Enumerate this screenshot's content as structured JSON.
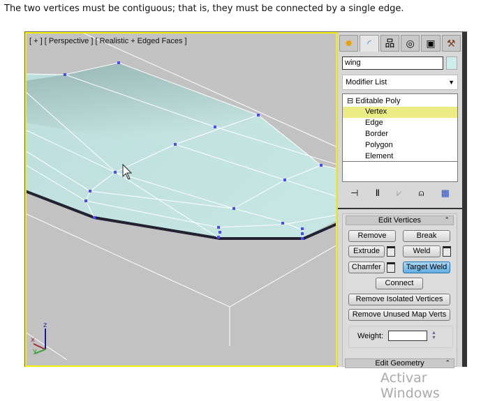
{
  "caption": "The two vertices must be contiguous; that is, they must be connected by a single edge.",
  "viewport": {
    "label": "[ + ] [ Perspective ] [ Realistic + Edged Faces ]",
    "axes": {
      "x": "x",
      "y": "y",
      "z": "z"
    }
  },
  "panel": {
    "tabs": [
      {
        "icon": "create-icon"
      },
      {
        "icon": "modify-icon"
      },
      {
        "icon": "hierarchy-icon"
      },
      {
        "icon": "motion-icon"
      },
      {
        "icon": "display-icon"
      },
      {
        "icon": "utilities-hammer-icon"
      }
    ],
    "object_name": "wing",
    "object_color": "#cdeeea",
    "modifier_list": "Modifier List",
    "stack": {
      "root": "Editable Poly",
      "items": [
        "Vertex",
        "Edge",
        "Border",
        "Polygon",
        "Element"
      ],
      "selected": "Vertex"
    },
    "edit_vertices": {
      "title": "Edit Vertices",
      "remove": "Remove",
      "break": "Break",
      "extrude": "Extrude",
      "weld": "Weld",
      "chamfer": "Chamfer",
      "target_weld": "Target Weld",
      "connect": "Connect",
      "remove_isolated": "Remove Isolated Vertices",
      "remove_unused": "Remove Unused Map Verts",
      "weight_label": "Weight:",
      "weight_value": ""
    },
    "edit_geometry": {
      "title": "Edit Geometry"
    }
  },
  "watermark": "Activar Windows",
  "colors": {
    "viewport_border": "#f5f000",
    "selection": "#ecec84",
    "active_button": "#62aee0",
    "vertex": "#4040ff"
  }
}
